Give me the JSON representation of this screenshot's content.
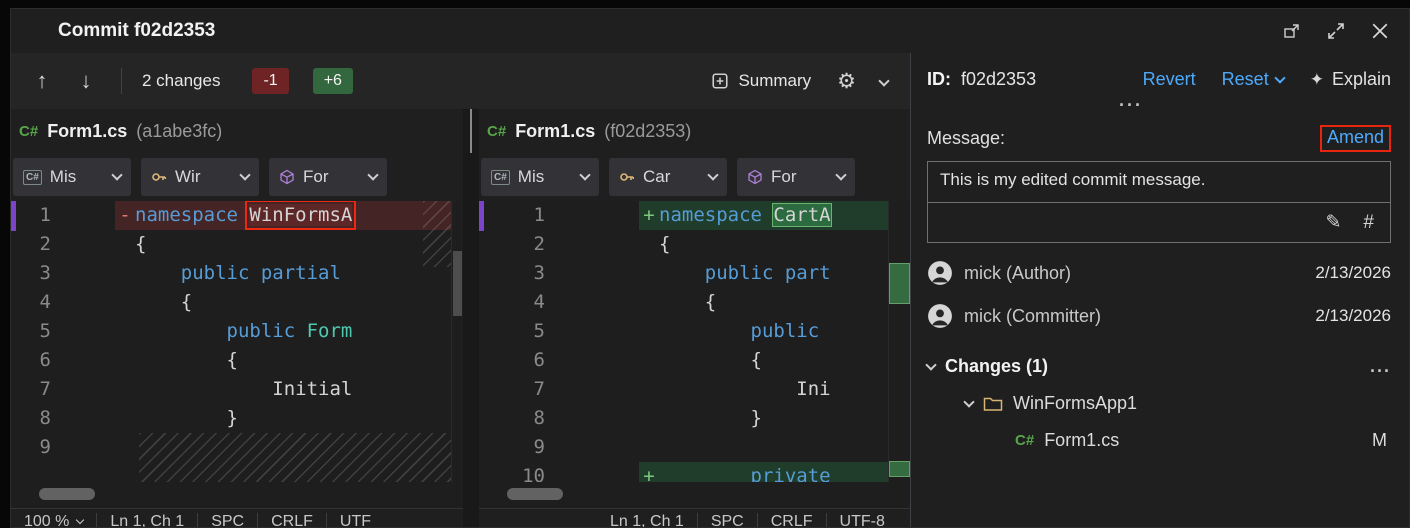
{
  "window": {
    "title": "Commit f02d2353"
  },
  "icons": {
    "up": "↑",
    "down": "↓",
    "gear": "⚙",
    "sparkle": "✦",
    "pen": "✎",
    "hash": "#",
    "csharp": "C#"
  },
  "toolbar": {
    "changes": "2 changes",
    "deletions": "-1",
    "additions": "+6",
    "summary": "Summary"
  },
  "panes": {
    "left": {
      "lang": "C#",
      "file": "Form1.cs",
      "ref": "(a1abe3fc)",
      "breadcrumbs": [
        "Mis",
        "Wir",
        "For"
      ],
      "status": {
        "zoom": "100 %",
        "caret": "Ln 1, Ch 1",
        "ws": "SPC",
        "eol": "CRLF",
        "enc": "UTF"
      }
    },
    "right": {
      "lang": "C#",
      "file": "Form1.cs",
      "ref": "(f02d2353)",
      "breadcrumbs": [
        "Mis",
        "Car",
        "For"
      ],
      "status": {
        "caret": "Ln 1, Ch 1",
        "ws": "SPC",
        "eol": "CRLF",
        "enc": "UTF-8"
      }
    }
  },
  "left_code": [
    {
      "n": "1",
      "marker": "-",
      "kind": "removed",
      "tokens": [
        {
          "t": "namespace ",
          "c": "kw"
        },
        {
          "t": "WinFormsA",
          "w": "removed",
          "a": true
        }
      ]
    },
    {
      "n": "2",
      "tokens": [
        {
          "t": "{"
        }
      ]
    },
    {
      "n": "3",
      "tokens": [
        {
          "t": "    "
        },
        {
          "t": "public",
          "c": "kw"
        },
        {
          "t": " "
        },
        {
          "t": "partial",
          "c": "kw"
        }
      ]
    },
    {
      "n": "4",
      "tokens": [
        {
          "t": "    {"
        }
      ]
    },
    {
      "n": "5",
      "tokens": [
        {
          "t": "        "
        },
        {
          "t": "public",
          "c": "kw"
        },
        {
          "t": " "
        },
        {
          "t": "Form",
          "c": "type"
        }
      ]
    },
    {
      "n": "6",
      "tokens": [
        {
          "t": "        {"
        }
      ]
    },
    {
      "n": "7",
      "tokens": [
        {
          "t": "            Initial"
        }
      ]
    },
    {
      "n": "8",
      "tokens": [
        {
          "t": "        }"
        }
      ]
    },
    {
      "n": "9",
      "tokens": []
    }
  ],
  "right_code": [
    {
      "n": "1",
      "marker": "+",
      "kind": "added",
      "tokens": [
        {
          "t": "namespace ",
          "c": "kw"
        },
        {
          "t": "CartA",
          "w": "added"
        }
      ]
    },
    {
      "n": "2",
      "tokens": [
        {
          "t": "{"
        }
      ]
    },
    {
      "n": "3",
      "tokens": [
        {
          "t": "    "
        },
        {
          "t": "public",
          "c": "kw"
        },
        {
          "t": " "
        },
        {
          "t": "part",
          "c": "kw"
        }
      ]
    },
    {
      "n": "4",
      "tokens": [
        {
          "t": "    {"
        }
      ]
    },
    {
      "n": "5",
      "tokens": [
        {
          "t": "        "
        },
        {
          "t": "public",
          "c": "kw"
        }
      ]
    },
    {
      "n": "6",
      "tokens": [
        {
          "t": "        {"
        }
      ]
    },
    {
      "n": "7",
      "tokens": [
        {
          "t": "            Ini"
        }
      ]
    },
    {
      "n": "8",
      "tokens": [
        {
          "t": "        }"
        }
      ]
    },
    {
      "n": "9",
      "tokens": []
    },
    {
      "n": "10",
      "marker": "+",
      "kind": "added",
      "tokens": [
        {
          "t": "        "
        },
        {
          "t": "private",
          "c": "kw"
        }
      ]
    }
  ],
  "details": {
    "id_label": "ID:",
    "id": "f02d2353",
    "revert": "Revert",
    "reset": "Reset",
    "explain": "Explain",
    "more": "...",
    "message_label": "Message:",
    "amend": "Amend",
    "message": "This is my edited commit message.",
    "author": "mick (Author)",
    "author_date": "2/13/2026",
    "committer": "mick (Committer)",
    "committer_date": "2/13/2026",
    "changes_header": "Changes (1)",
    "changes_more": "...",
    "folder": "WinFormsApp1",
    "file_lang": "C#",
    "file": "Form1.cs",
    "file_status": "M"
  }
}
